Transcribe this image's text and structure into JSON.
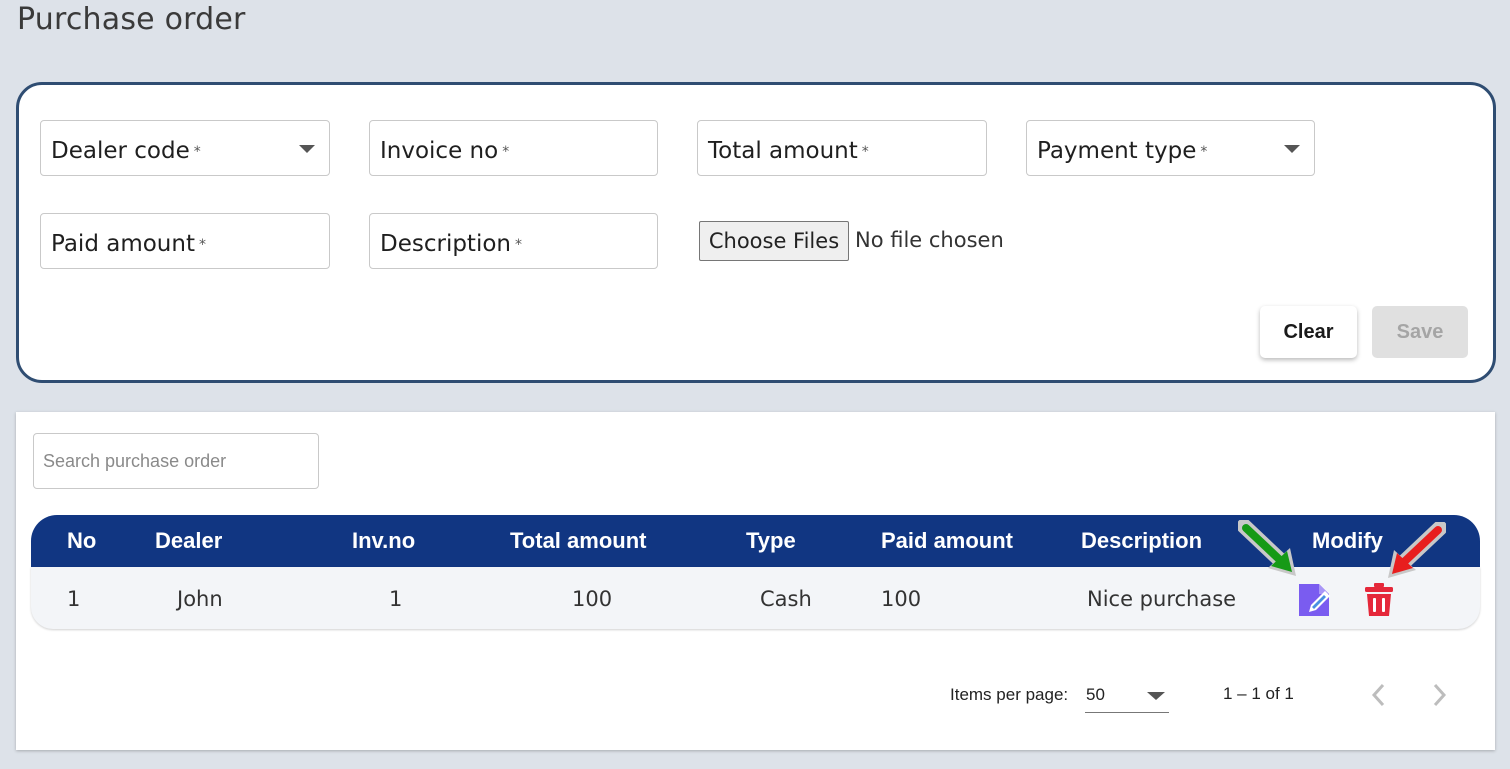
{
  "page": {
    "title": "Purchase order"
  },
  "form": {
    "fields": {
      "dealer_code": {
        "label": "Dealer code",
        "required": "*"
      },
      "invoice_no": {
        "label": "Invoice no",
        "required": "*"
      },
      "total_amount": {
        "label": "Total amount",
        "required": "*"
      },
      "payment_type": {
        "label": "Payment type",
        "required": "*"
      },
      "paid_amount": {
        "label": "Paid amount",
        "required": "*"
      },
      "description": {
        "label": "Description",
        "required": "*"
      }
    },
    "file": {
      "button": "Choose Files",
      "status": "No file chosen"
    },
    "clear_label": "Clear",
    "save_label": "Save"
  },
  "table": {
    "search_placeholder": "Search purchase order",
    "columns": [
      "No",
      "Dealer",
      "Inv.no",
      "Total amount",
      "Type",
      "Paid amount",
      "Description",
      "Modify"
    ],
    "rows": [
      {
        "no": "1",
        "dealer": "John",
        "inv_no": "1",
        "total_amount": "100",
        "type": "Cash",
        "paid_amount": "100",
        "description": "Nice purchase",
        "actions": [
          "edit-icon",
          "delete-icon"
        ]
      }
    ]
  },
  "paginator": {
    "items_per_page_label": "Items per page:",
    "items_per_page": "50",
    "range": "1 – 1 of 1"
  },
  "colors": {
    "header_bg": "#113682",
    "card_border": "#2f4d72",
    "edit_icon": "#7a5cf0",
    "delete_icon": "#e5283a",
    "arrow_green": "#169a16",
    "arrow_red": "#e81e1e"
  }
}
